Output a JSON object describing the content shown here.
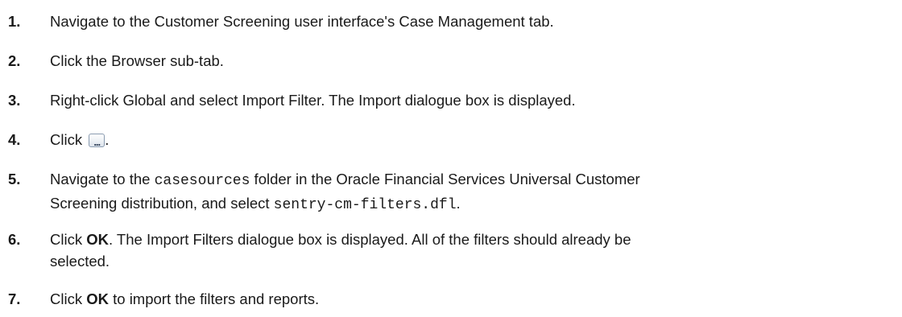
{
  "steps": [
    {
      "num": "1.",
      "text": "Navigate to the Customer Screening user interface's Case Management tab."
    },
    {
      "num": "2.",
      "text": "Click the Browser sub-tab."
    },
    {
      "num": "3.",
      "text": "Right-click Global and select Import Filter. The Import dialogue box is displayed."
    },
    {
      "num": "4.",
      "click": "Click",
      "icon": "ellipsis-button-icon",
      "tail": "."
    },
    {
      "num": "5.",
      "a": "Navigate to the ",
      "code1": "casesources",
      "b": " folder in the Oracle Financial Services Universal Customer",
      "c": "Screening distribution, and select ",
      "code2": "sentry-cm-filters.dfl",
      "d": "."
    },
    {
      "num": "6.",
      "a": "Click ",
      "bold": "OK",
      "b": ". The Import Filters dialogue box is displayed. All of the filters should already be",
      "c": "selected."
    },
    {
      "num": "7.",
      "a": "Click ",
      "bold": "OK",
      "b": " to import the filters and reports."
    }
  ]
}
